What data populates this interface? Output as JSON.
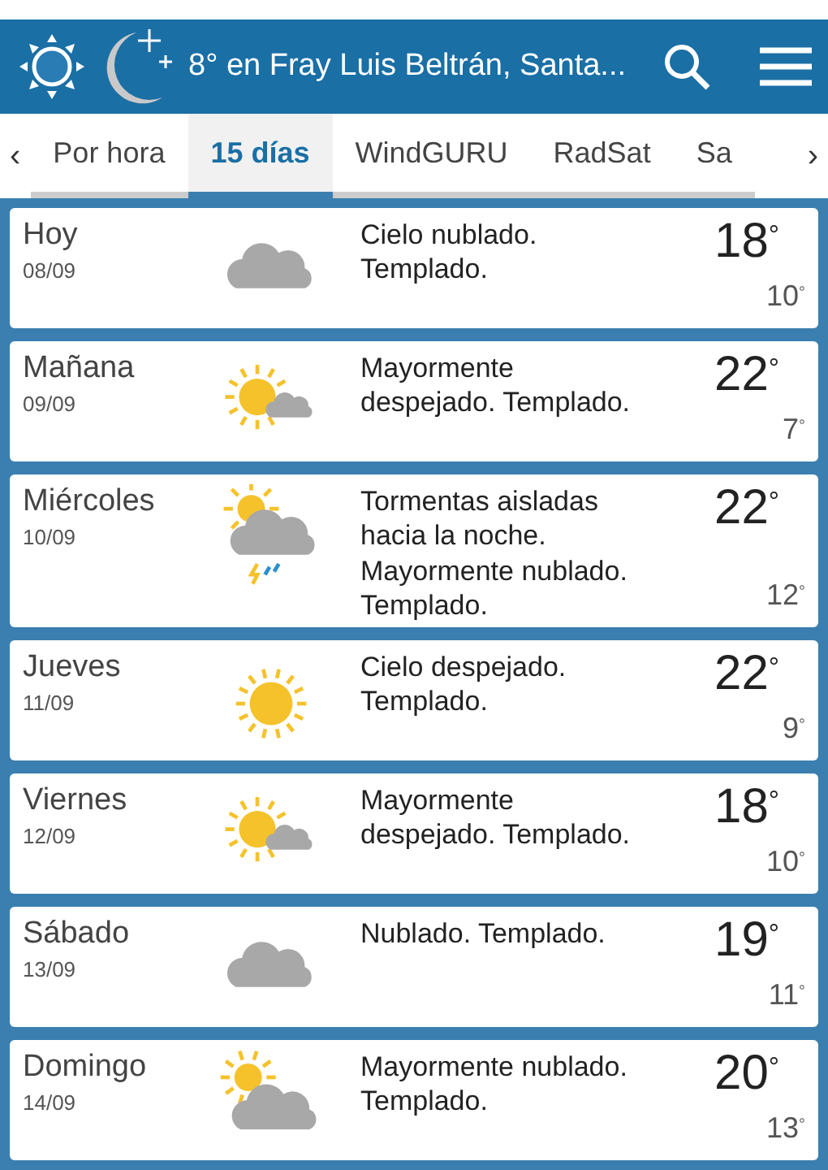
{
  "header": {
    "title": "8° en Fray Luis Beltrán, Santa..."
  },
  "tab_scroll": {
    "left": "‹",
    "right": "›"
  },
  "tabs": [
    {
      "label": "Por hora",
      "selected": false
    },
    {
      "label": "15 días",
      "selected": true
    },
    {
      "label": "WindGURU",
      "selected": false
    },
    {
      "label": "RadSat",
      "selected": false
    },
    {
      "label": "Sa",
      "selected": false
    }
  ],
  "days": [
    {
      "day": "Hoy",
      "date": "08/09",
      "kind": "cloudy",
      "description": "Cielo nublado. Templado.",
      "high": "18$^{°}$",
      "low": "10$^{°}$"
    },
    {
      "day": "Mañana",
      "date": "09/09",
      "kind": "partly",
      "description": "Mayormente despejado. Templado.",
      "high": "22$^{°}$",
      "low": "7$^{°}$"
    },
    {
      "day": "Miércoles",
      "date": "10/09",
      "kind": "storm",
      "description": "Tormentas aisladas hacia la noche. Mayormente nublado. Templado.",
      "high": "22$^{°}$",
      "low": "12$^{°}$"
    },
    {
      "day": "Jueves",
      "date": "11/09",
      "kind": "sunny",
      "description": "Cielo despejado. Templado.",
      "high": "22$^{°}$",
      "low": "9$^{°}$"
    },
    {
      "day": "Viernes",
      "date": "12/09",
      "kind": "partly",
      "description": "Mayormente despejado. Templado.",
      "high": "18$^{°}$",
      "low": "10$^{°}$"
    },
    {
      "day": "Sábado",
      "date": "13/09",
      "kind": "cloudy",
      "description": "Nublado. Templado.",
      "high": "19$^{°}$",
      "low": "11$^{°}$"
    },
    {
      "day": "Domingo",
      "date": "14/09",
      "kind": "mostly_cloudy",
      "description": "Mayormente nublado. Templado.",
      "high": "20$^{°}$",
      "low": "13$^{°}$"
    }
  ]
}
